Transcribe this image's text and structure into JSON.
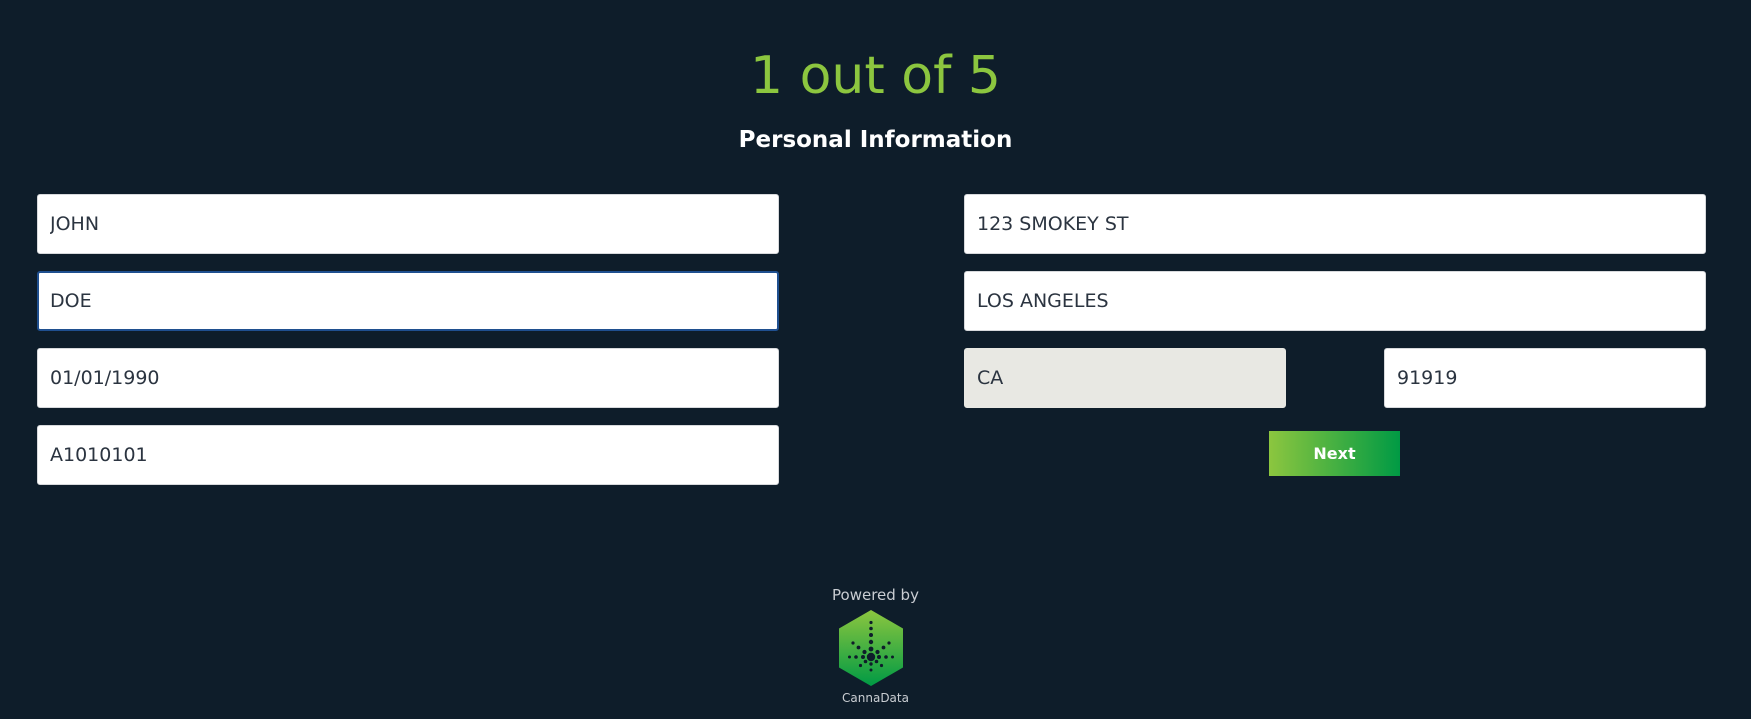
{
  "header": {
    "step": "1 out of 5",
    "section_title": "Personal Information"
  },
  "form": {
    "first_name": "JOHN",
    "last_name": "DOE",
    "dob": "01/01/1990",
    "license_number": "A1010101",
    "street": "123 SMOKEY ST",
    "city": "LOS ANGELES",
    "state": "CA",
    "zip": "91919"
  },
  "actions": {
    "next_label": "Next"
  },
  "footer": {
    "powered_by": "Powered by",
    "brand_name": "CannaData",
    "logo_icon": "cannadata-hexagon-leaf-icon"
  },
  "colors": {
    "background": "#0e1d2a",
    "accent": "#8cc63f",
    "accent_dark": "#009a44",
    "focus_border": "#1f4f8f",
    "disabled_field": "#e8e8e3"
  }
}
